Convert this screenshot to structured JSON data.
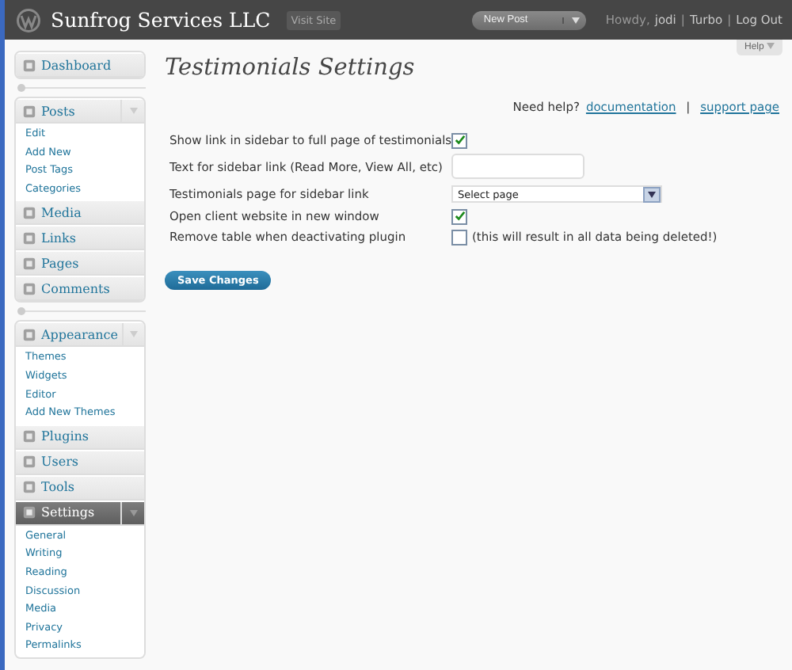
{
  "header": {
    "site_title": "Sunfrog Services LLC",
    "visit_site": "Visit Site",
    "new_post": "New Post",
    "greeting": "Howdy,",
    "user": "jodi",
    "separator": "|",
    "links": [
      "Turbo",
      "Log Out"
    ]
  },
  "help_tab": "Help",
  "sidebar": {
    "groups": [
      {
        "items": [
          {
            "label": "Dashboard",
            "selected": false
          }
        ]
      },
      {
        "items": [
          {
            "label": "Posts",
            "selected": false,
            "children": [
              "Edit",
              "Add New",
              "Post Tags",
              "Categories"
            ]
          },
          {
            "label": "Media",
            "selected": false
          },
          {
            "label": "Links",
            "selected": false
          },
          {
            "label": "Pages",
            "selected": false
          },
          {
            "label": "Comments",
            "selected": false
          }
        ]
      },
      {
        "items": [
          {
            "label": "Appearance",
            "selected": false,
            "children": [
              "Themes",
              "Widgets",
              "Editor",
              "Add New Themes"
            ]
          },
          {
            "label": "Plugins",
            "selected": false
          },
          {
            "label": "Users",
            "selected": false
          },
          {
            "label": "Tools",
            "selected": false
          },
          {
            "label": "Settings",
            "selected": true,
            "children": [
              "General",
              "Writing",
              "Reading",
              "Discussion",
              "Media",
              "Privacy",
              "Permalinks"
            ]
          }
        ]
      }
    ]
  },
  "page_title": "Testimonials Settings",
  "help_line": {
    "prefix": "Need help?",
    "links": [
      "documentation",
      "support page"
    ],
    "separator": "|"
  },
  "settings": [
    {
      "kind": "checkbox",
      "label": "Show link in sidebar to full page of testimonials",
      "checked": true
    },
    {
      "kind": "text",
      "label": "Text for sidebar link (Read More, View All, etc)"
    },
    {
      "kind": "select",
      "label": "Testimonials page for sidebar link",
      "value": "Select page"
    },
    {
      "kind": "checkbox",
      "label": "Open client website in new window",
      "checked": true
    },
    {
      "kind": "checkbox",
      "label": "Remove table when deactivating plugin",
      "checked": false,
      "note": "(this will result in all data being deleted!)"
    }
  ],
  "save_button": "Save Changes"
}
